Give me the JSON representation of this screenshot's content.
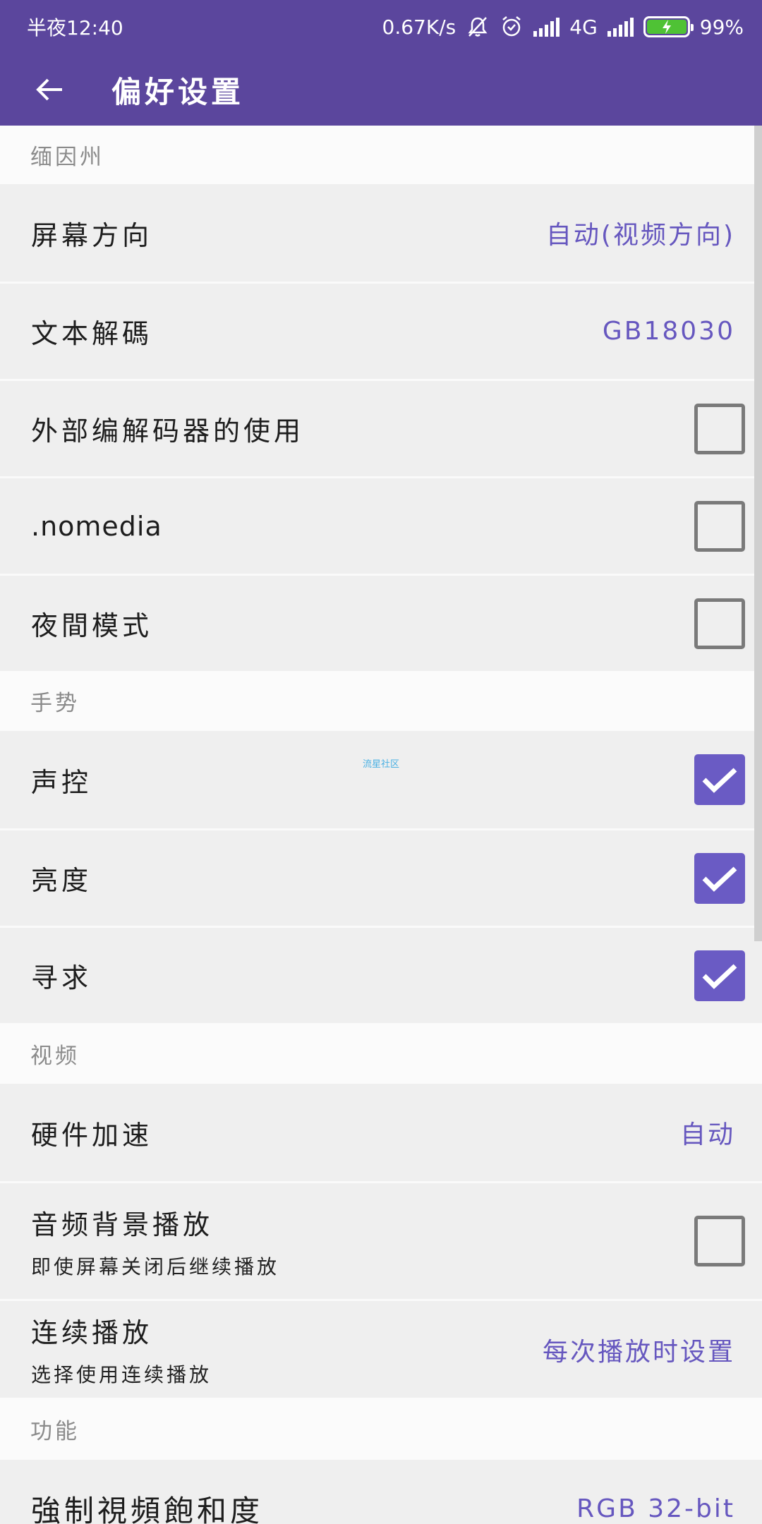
{
  "status_bar": {
    "time": "半夜12:40",
    "speed": "0.67K/s",
    "network": "4G",
    "battery": "99%"
  },
  "app_bar": {
    "title": "偏好设置"
  },
  "sections": {
    "interface": {
      "header": "缅因州",
      "screen_orientation": {
        "title": "屏幕方向",
        "value": "自动(视频方向)"
      },
      "text_encoding": {
        "title": "文本解碼",
        "value": "GB18030"
      },
      "external_codec": {
        "title": "外部编解码器的使用",
        "checked": false
      },
      "nomedia": {
        "title": ".nomedia",
        "checked": false
      },
      "night_mode": {
        "title": "夜間模式",
        "checked": false
      }
    },
    "gestures": {
      "header": "手势",
      "watermark": "流星社区",
      "voice_control": {
        "title": "声控",
        "checked": true
      },
      "brightness": {
        "title": "亮度",
        "checked": true
      },
      "seek": {
        "title": "寻求",
        "checked": true
      }
    },
    "video": {
      "header": "视频",
      "hardware_accel": {
        "title": "硬件加速",
        "value": "自动"
      },
      "background_audio": {
        "title": "音频背景播放",
        "summary": "即使屏幕关闭后继续播放",
        "checked": false
      },
      "continuous_play": {
        "title": "连续播放",
        "summary": "选择使用连续播放",
        "value": "每次播放时设置"
      }
    },
    "features": {
      "header": "功能",
      "force_saturation": {
        "title": "強制視頻飽和度",
        "value": "RGB 32-bit"
      }
    }
  },
  "colors": {
    "primary": "#5b469d",
    "accent": "#6a5bc4",
    "value_text": "#6657bf",
    "battery_fill": "#4fc235"
  },
  "icons": [
    "back-arrow-icon",
    "mute-bell-icon",
    "alarm-icon",
    "signal-icon",
    "battery-icon",
    "checkmark-icon"
  ]
}
